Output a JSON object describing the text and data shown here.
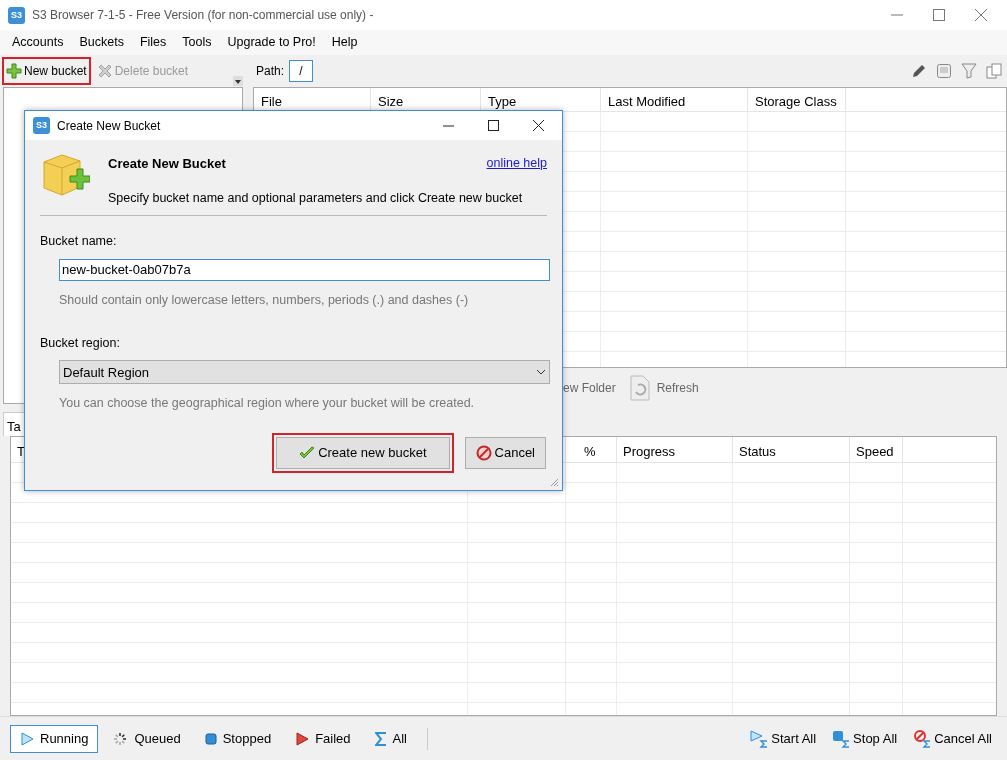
{
  "window": {
    "icon_text": "S3",
    "title": "S3 Browser 7-1-5 - Free Version (for non-commercial use only) -"
  },
  "menu": [
    "Accounts",
    "Buckets",
    "Files",
    "Tools",
    "Upgrade to Pro!",
    "Help"
  ],
  "bucket_toolbar": [
    {
      "label": "New bucket",
      "highlighted": true,
      "disabled": false
    },
    {
      "label": "Delete bucket",
      "highlighted": false,
      "disabled": true
    }
  ],
  "path": {
    "label": "Path:",
    "value": "/"
  },
  "files_table": {
    "columns": [
      "File",
      "Size",
      "Type",
      "Last Modified",
      "Storage Class"
    ]
  },
  "files_toolbar": [
    "ew Folder",
    "Refresh"
  ],
  "tasks": {
    "tab": "Ta",
    "columns": [
      "T",
      "%",
      "Progress",
      "Status",
      "Speed"
    ]
  },
  "task_filters": [
    {
      "label": "Running",
      "selected": true
    },
    {
      "label": "Queued",
      "selected": false
    },
    {
      "label": "Stopped",
      "selected": false
    },
    {
      "label": "Failed",
      "selected": false
    },
    {
      "label": "All",
      "selected": false
    }
  ],
  "task_actions": [
    "Start All",
    "Stop All",
    "Cancel All"
  ],
  "dialog": {
    "icon_text": "S3",
    "title": "Create New Bucket",
    "heading": "Create New Bucket",
    "description": "Specify bucket name and optional parameters and click Create new bucket",
    "help_link": "online help",
    "name_label": "Bucket name:",
    "name_value": "new-bucket-0ab07b7a",
    "name_hint": "Should contain only lowercase letters, numbers, periods (.) and dashes (-)",
    "region_label": "Bucket region:",
    "region_value": "Default Region",
    "region_hint": "You can choose the geographical region where your bucket will be created.",
    "buttons": [
      {
        "label": "Create new bucket",
        "highlighted": true
      },
      {
        "label": "Cancel",
        "highlighted": false
      }
    ]
  }
}
